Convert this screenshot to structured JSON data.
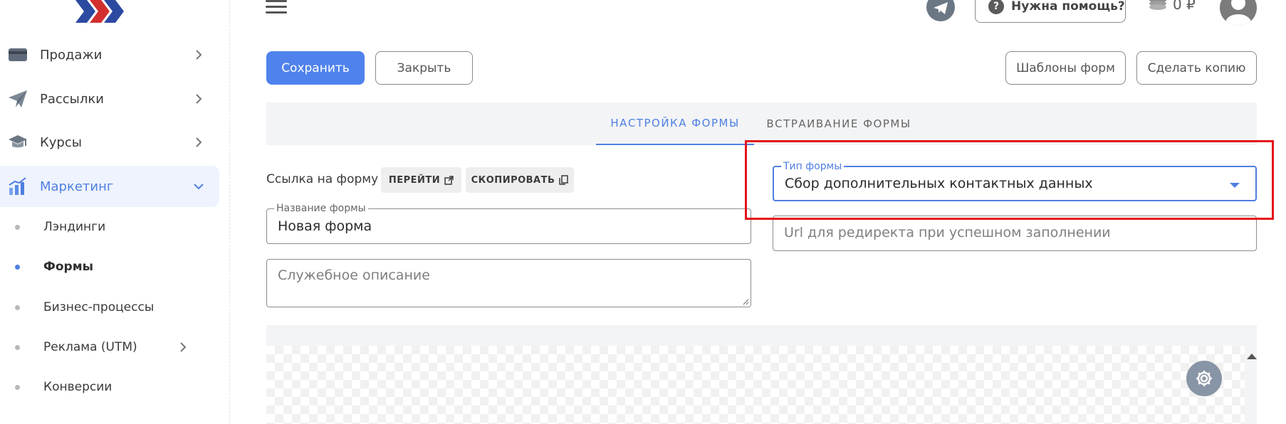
{
  "sidebar": {
    "items": [
      {
        "label": "Продажи",
        "icon": "card-icon"
      },
      {
        "label": "Рассылки",
        "icon": "paper-plane-icon"
      },
      {
        "label": "Курсы",
        "icon": "graduation-cap-icon"
      },
      {
        "label": "Маркетинг",
        "icon": "chart-icon"
      }
    ],
    "sub_items": [
      {
        "label": "Лэндинги"
      },
      {
        "label": "Формы"
      },
      {
        "label": "Бизнес-процессы"
      },
      {
        "label": "Реклама (UTM)"
      },
      {
        "label": "Конверсии"
      }
    ]
  },
  "header": {
    "help_label": "Нужна помощь?",
    "balance": "0 ₽"
  },
  "actions": {
    "save": "Сохранить",
    "close": "Закрыть",
    "templates": "Шаблоны форм",
    "copy": "Сделать копию"
  },
  "tabs": [
    {
      "label": "НАСТРОЙКА ФОРМЫ",
      "active": true
    },
    {
      "label": "ВСТРАИВАНИЕ ФОРМЫ",
      "active": false
    }
  ],
  "form": {
    "link_label": "Ссылка на форму",
    "goto_chip": "ПЕРЕЙТИ",
    "copy_chip": "СКОПИРОВАТЬ",
    "name_legend": "Название формы",
    "name_value": "Новая форма",
    "desc_placeholder": "Служебное описание",
    "type_legend": "Тип формы",
    "type_value": "Сбор дополнительных контактных данных",
    "redirect_placeholder": "Url для редиректа при успешном заполнении"
  },
  "colors": {
    "accent": "#4e7fe0",
    "primary_button": "#4f82ec",
    "highlight_box": "#e3121b"
  }
}
